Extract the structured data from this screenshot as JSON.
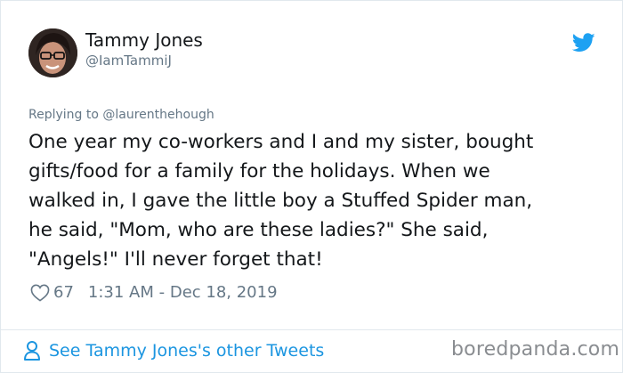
{
  "author": {
    "name": "Tammy Jones",
    "handle": "@IamTammiJ"
  },
  "reply": {
    "prefix": "Replying to ",
    "mention": "@laurenthehough"
  },
  "tweet": {
    "text": "One year my co-workers and I and my sister, bought\ngifts/food for a family for the holidays. When we\nwalked in, I gave the little boy a Stuffed Spider man,\nhe said, \"Mom, who are these ladies?\" She said,\n\"Angels!\"    I'll never forget that!"
  },
  "meta": {
    "likes": "67",
    "timestamp": "1:31 AM - Dec 18, 2019"
  },
  "footer": {
    "see_more_label": "See Tammy Jones's other Tweets",
    "watermark": "boredpanda.com"
  },
  "colors": {
    "link": "#1b95e0",
    "twitter_blue": "#1da1f2",
    "muted": "#657786"
  },
  "icons": {
    "brand": "twitter-bird-icon",
    "like": "heart-icon",
    "profile": "person-icon"
  }
}
